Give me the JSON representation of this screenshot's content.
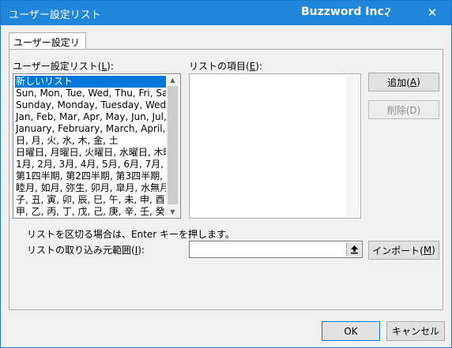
{
  "titlebar": {
    "title": "ユーザー設定リスト",
    "brand": "Buzzword Inc.",
    "help_glyph": "?",
    "close_glyph": "✕"
  },
  "tabs": [
    {
      "label": "ユーザー設定リスト"
    }
  ],
  "custom_lists": {
    "label_prefix": "ユーザー設定リスト(",
    "label_accel": "L",
    "label_suffix": "):",
    "items": [
      "新しいリスト",
      "Sun, Mon, Tue, Wed, Thu, Fri, Sa",
      "Sunday, Monday, Tuesday, Wedn",
      "Jan, Feb, Mar, Apr, May, Jun, Jul,",
      "January, February, March, April,",
      "日, 月, 火, 水, 木, 金, 土",
      "日曜日, 月曜日, 火曜日, 水曜日, 木曜",
      "1月, 2月, 3月, 4月, 5月, 6月, 7月,",
      "第1四半期, 第2四半期, 第3四半期, 第",
      "睦月, 如月, 弥生, 卯月, 皐月, 水無月",
      "子, 丑, 寅, 卯, 辰, 巳, 午, 未, 申, 酉",
      "甲, 乙, 丙, 丁, 戊, 己, 庚, 辛, 壬, 癸"
    ],
    "selected_index": 0
  },
  "list_entries": {
    "label_prefix": "リストの項目(",
    "label_accel": "E",
    "label_suffix": "):",
    "value": ""
  },
  "buttons": {
    "add": {
      "prefix": "追加(",
      "accel": "A",
      "suffix": ")"
    },
    "delete": {
      "label": "削除(D)"
    },
    "import": {
      "prefix": "インポート(",
      "accel": "M",
      "suffix": ")"
    },
    "ok": "OK",
    "cancel": "キャンセル"
  },
  "hint": "リストを区切る場合は、Enter キーを押します。",
  "import_range": {
    "label_prefix": "リストの取り込み元範囲(",
    "label_accel": "I",
    "label_suffix": "):",
    "value": "",
    "picker_icon": "collapse-dialog-icon"
  }
}
